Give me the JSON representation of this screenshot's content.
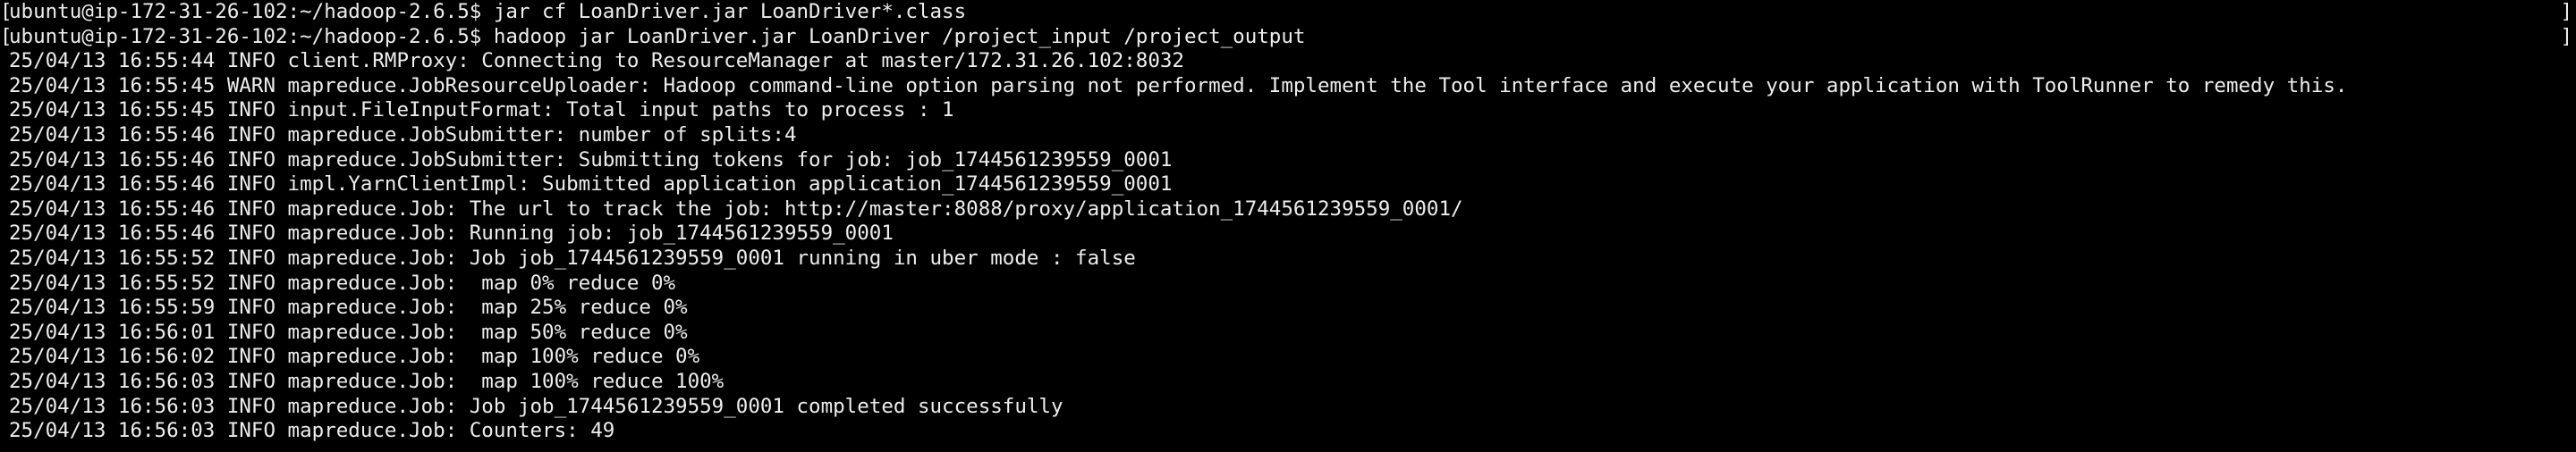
{
  "colors": {
    "background": "#000000",
    "foreground": "#ededed"
  },
  "terminal": {
    "lines": [
      {
        "bracket": true,
        "text": "ubuntu@ip-172-31-26-102:~/hadoop-2.6.5$ jar cf LoanDriver.jar LoanDriver*.class"
      },
      {
        "bracket": true,
        "text": "ubuntu@ip-172-31-26-102:~/hadoop-2.6.5$ hadoop jar LoanDriver.jar LoanDriver /project_input /project_output"
      },
      {
        "bracket": false,
        "text": "25/04/13 16:55:44 INFO client.RMProxy: Connecting to ResourceManager at master/172.31.26.102:8032"
      },
      {
        "bracket": false,
        "text": "25/04/13 16:55:45 WARN mapreduce.JobResourceUploader: Hadoop command-line option parsing not performed. Implement the Tool interface and execute your application with ToolRunner to remedy this."
      },
      {
        "bracket": false,
        "text": "25/04/13 16:55:45 INFO input.FileInputFormat: Total input paths to process : 1"
      },
      {
        "bracket": false,
        "text": "25/04/13 16:55:46 INFO mapreduce.JobSubmitter: number of splits:4"
      },
      {
        "bracket": false,
        "text": "25/04/13 16:55:46 INFO mapreduce.JobSubmitter: Submitting tokens for job: job_1744561239559_0001"
      },
      {
        "bracket": false,
        "text": "25/04/13 16:55:46 INFO impl.YarnClientImpl: Submitted application application_1744561239559_0001"
      },
      {
        "bracket": false,
        "text": "25/04/13 16:55:46 INFO mapreduce.Job: The url to track the job: http://master:8088/proxy/application_1744561239559_0001/"
      },
      {
        "bracket": false,
        "text": "25/04/13 16:55:46 INFO mapreduce.Job: Running job: job_1744561239559_0001"
      },
      {
        "bracket": false,
        "text": "25/04/13 16:55:52 INFO mapreduce.Job: Job job_1744561239559_0001 running in uber mode : false"
      },
      {
        "bracket": false,
        "text": "25/04/13 16:55:52 INFO mapreduce.Job:  map 0% reduce 0%"
      },
      {
        "bracket": false,
        "text": "25/04/13 16:55:59 INFO mapreduce.Job:  map 25% reduce 0%"
      },
      {
        "bracket": false,
        "text": "25/04/13 16:56:01 INFO mapreduce.Job:  map 50% reduce 0%"
      },
      {
        "bracket": false,
        "text": "25/04/13 16:56:02 INFO mapreduce.Job:  map 100% reduce 0%"
      },
      {
        "bracket": false,
        "text": "25/04/13 16:56:03 INFO mapreduce.Job:  map 100% reduce 100%"
      },
      {
        "bracket": false,
        "text": "25/04/13 16:56:03 INFO mapreduce.Job: Job job_1744561239559_0001 completed successfully"
      },
      {
        "bracket": false,
        "text": "25/04/13 16:56:03 INFO mapreduce.Job: Counters: 49"
      }
    ],
    "bracket_left": "[",
    "bracket_right": "]"
  }
}
